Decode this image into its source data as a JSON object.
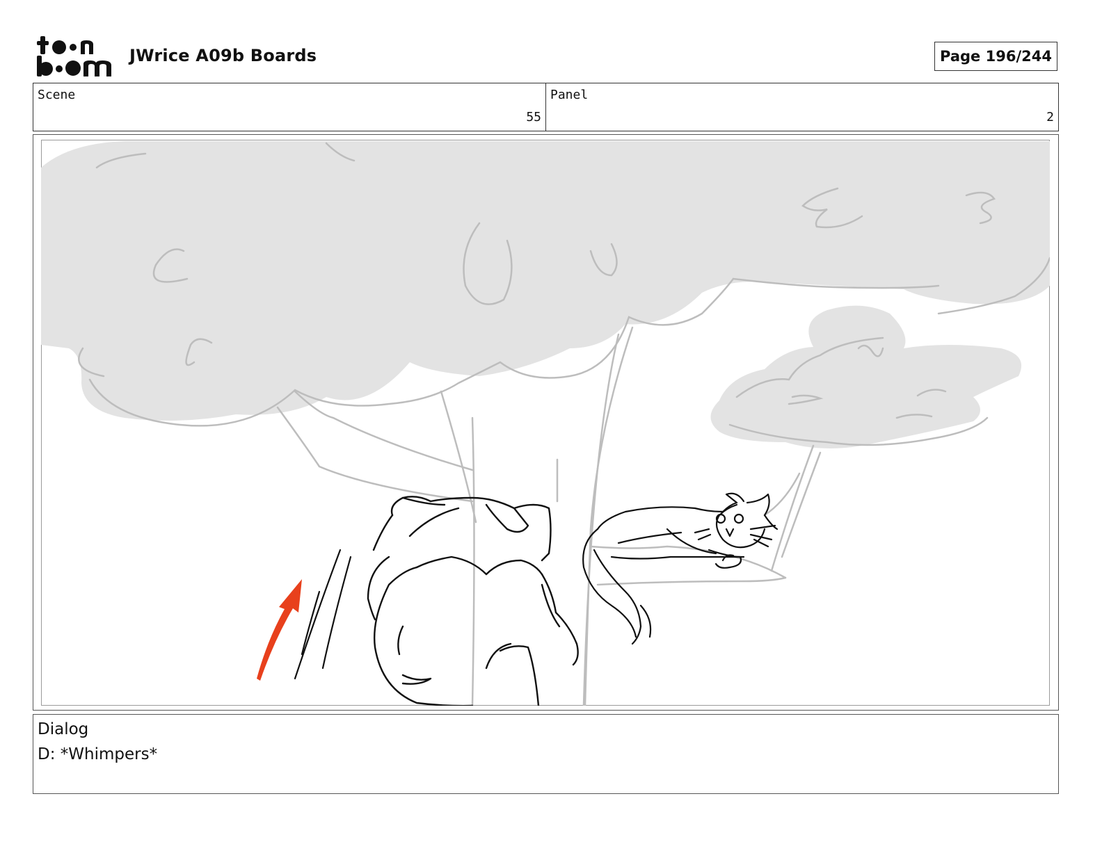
{
  "header": {
    "logo_text_top": "toon",
    "logo_text_bottom": "boom",
    "title": "JWrice A09b Boards",
    "page_label": "Page 196/244"
  },
  "info": {
    "scene_label": "Scene",
    "scene_value": "55",
    "panel_label": "Panel",
    "panel_value": "2"
  },
  "panel": {
    "sketch_colors": {
      "ink": "#111111",
      "foliage": "#e3e3e3",
      "construction": "#bdbdbd",
      "motion_arrow": "#e8401c"
    }
  },
  "dialog": {
    "label": "Dialog",
    "text": "D: *Whimpers*"
  }
}
